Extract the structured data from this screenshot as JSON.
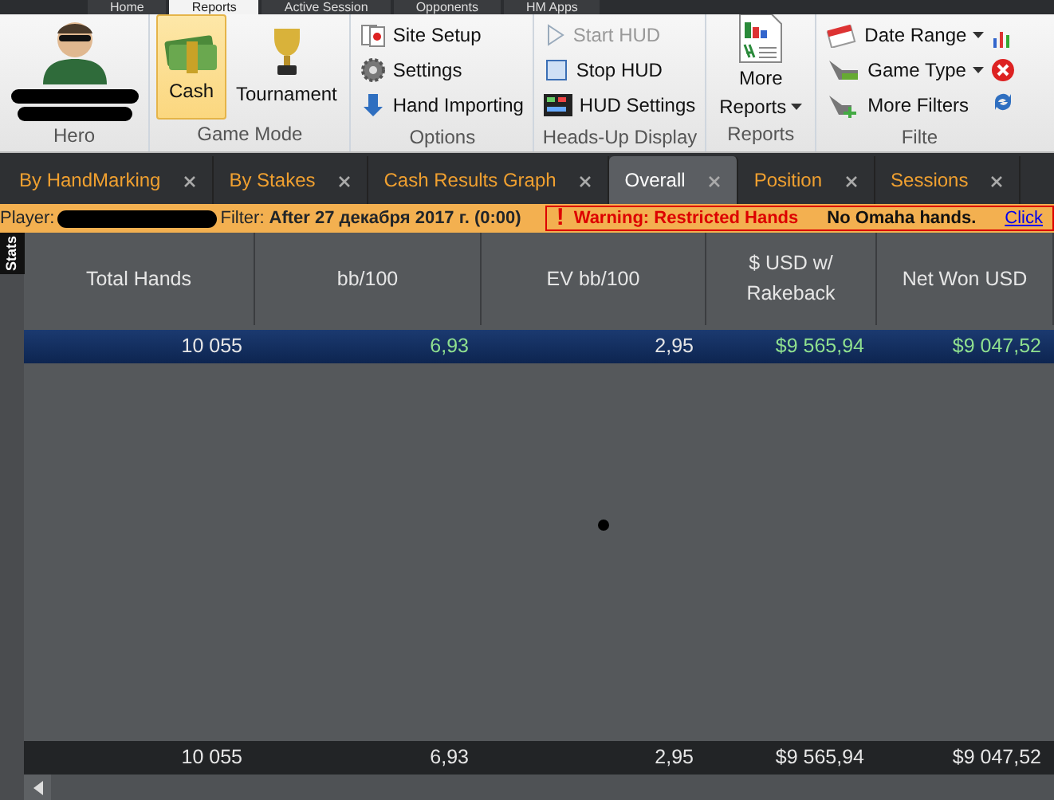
{
  "menu_tabs": [
    {
      "label": "Home",
      "selected": false
    },
    {
      "label": "Reports",
      "selected": true
    },
    {
      "label": "Active Session",
      "selected": false
    },
    {
      "label": "Opponents",
      "selected": false
    },
    {
      "label": "HM Apps",
      "selected": false
    }
  ],
  "ribbon": {
    "hero": {
      "label": "Hero"
    },
    "game_mode": {
      "label": "Game Mode",
      "buttons": [
        {
          "label": "Cash",
          "selected": true
        },
        {
          "label": "Tournament",
          "selected": false
        }
      ]
    },
    "options": {
      "label": "Options",
      "items": [
        {
          "label": "Site Setup",
          "disabled": false,
          "dropdown": false
        },
        {
          "label": "Settings",
          "disabled": false,
          "dropdown": false
        },
        {
          "label": "Hand Importing",
          "disabled": false,
          "dropdown": false
        }
      ]
    },
    "hud": {
      "label": "Heads-Up Display",
      "items": [
        {
          "label": "Start HUD",
          "disabled": true,
          "dropdown": false
        },
        {
          "label": "Stop HUD",
          "disabled": false,
          "dropdown": false
        },
        {
          "label": "HUD Settings",
          "disabled": false,
          "dropdown": false
        }
      ]
    },
    "reports": {
      "label": "Reports",
      "button": "More Reports"
    },
    "filters": {
      "label": "Filte",
      "items": [
        {
          "label": "Date Range",
          "disabled": false,
          "dropdown": true
        },
        {
          "label": "Game Type",
          "disabled": false,
          "dropdown": true
        },
        {
          "label": "More Filters",
          "disabled": false,
          "dropdown": false
        }
      ]
    }
  },
  "report_tabs": [
    {
      "label": "By HandMarking",
      "selected": false
    },
    {
      "label": "By Stakes",
      "selected": false
    },
    {
      "label": "Cash Results Graph",
      "selected": false
    },
    {
      "label": "Overall",
      "selected": true
    },
    {
      "label": "Position",
      "selected": false
    },
    {
      "label": "Sessions",
      "selected": false
    }
  ],
  "filter_bar": {
    "player_label": "Player:",
    "filter_label": "Filter:",
    "filter_value": "After 27 декабря 2017 г. (0:00)",
    "warning": "Warning: Restricted Hands",
    "warning_icon": "!",
    "note": "No Omaha hands.",
    "link": "Click"
  },
  "side_tab": "Stats",
  "table": {
    "columns": [
      "Total Hands",
      "bb/100",
      "EV bb/100",
      "$ USD w/ Rakeback",
      "Net Won USD"
    ],
    "rows": [
      {
        "selected": true,
        "cells": [
          {
            "text": "10 055",
            "positive": false
          },
          {
            "text": "6,93",
            "positive": true
          },
          {
            "text": "2,95",
            "positive": false
          },
          {
            "text": "$9 565,94",
            "positive": true
          },
          {
            "text": "$9 047,52",
            "positive": true
          }
        ]
      }
    ],
    "totals": [
      "10 055",
      "6,93",
      "2,95",
      "$9 565,94",
      "$9 047,52"
    ]
  }
}
